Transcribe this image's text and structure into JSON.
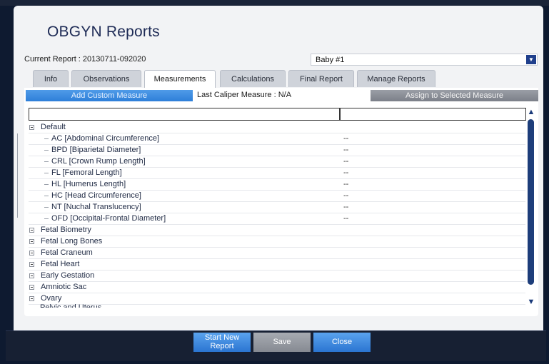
{
  "app": {
    "title": "OBGYN Reports"
  },
  "report": {
    "current_label": "Current Report : 20130711-092020",
    "baby_select_value": "Baby #1"
  },
  "tabs": [
    {
      "label": "Info"
    },
    {
      "label": "Observations"
    },
    {
      "label": "Measurements"
    },
    {
      "label": "Calculations"
    },
    {
      "label": "Final Report"
    },
    {
      "label": "Manage Reports"
    }
  ],
  "toolbar": {
    "add_custom_label": "Add Custom Measure",
    "caliper_label": "Last Caliper Measure : N/A",
    "assign_label": "Assign to Selected Measure"
  },
  "tree": {
    "default_group": "Default",
    "default_items": [
      {
        "label": "AC [Abdominal Circumference]",
        "value": "--"
      },
      {
        "label": "BPD [Biparietal Diameter]",
        "value": "--"
      },
      {
        "label": "CRL [Crown Rump Length]",
        "value": "--"
      },
      {
        "label": "FL [Femoral Length]",
        "value": "--"
      },
      {
        "label": "HL [Humerus Length]",
        "value": "--"
      },
      {
        "label": "HC [Head Circumference]",
        "value": "--"
      },
      {
        "label": "NT [Nuchal Translucency]",
        "value": "--"
      },
      {
        "label": "OFD [Occipital-Frontal Diameter]",
        "value": "--"
      }
    ],
    "groups": [
      {
        "label": "Fetal Biometry"
      },
      {
        "label": "Fetal Long Bones"
      },
      {
        "label": "Fetal Craneum"
      },
      {
        "label": "Fetal Heart"
      },
      {
        "label": "Early Gestation"
      },
      {
        "label": "Amniotic Sac"
      },
      {
        "label": "Ovary"
      }
    ],
    "partial_row": "Pelvic and Uterus"
  },
  "footer": {
    "start_new_label_1": "Start New",
    "start_new_label_2": "Report",
    "save_label": "Save",
    "close_label": "Close"
  }
}
